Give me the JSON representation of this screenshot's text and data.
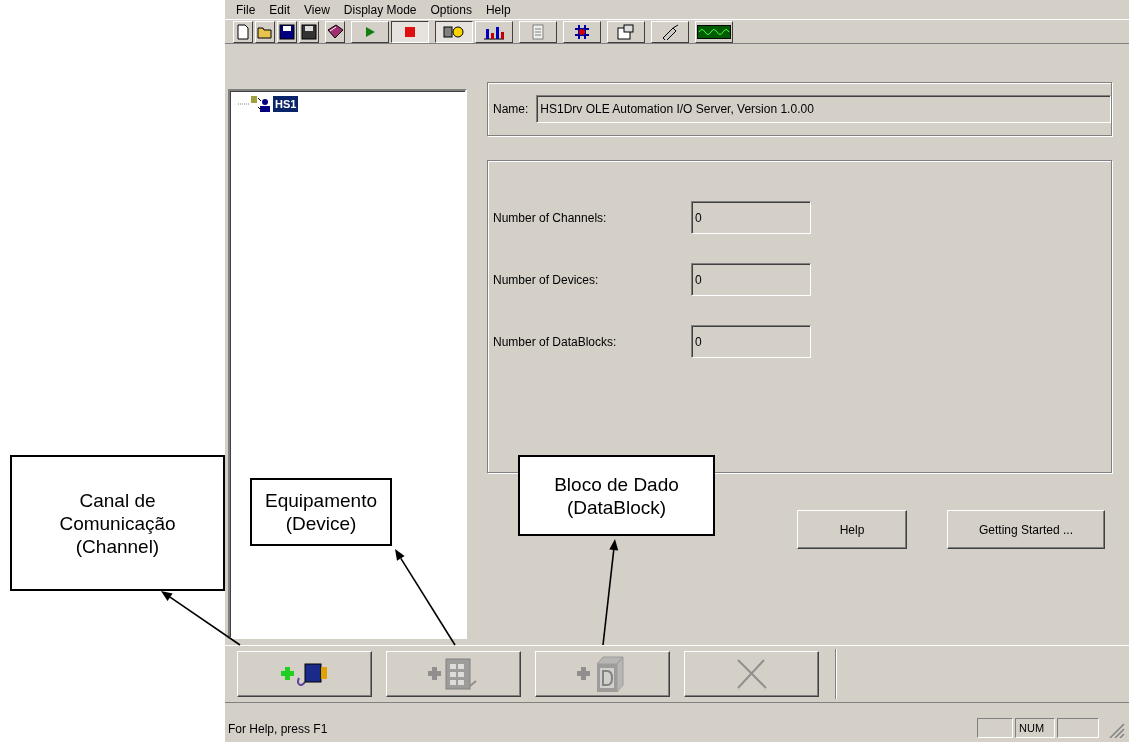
{
  "menu": [
    "File",
    "Edit",
    "View",
    "Display Mode",
    "Options",
    "Help"
  ],
  "toolbar": [
    [
      {
        "kind": "new",
        "pressed": false
      },
      {
        "kind": "open",
        "pressed": false
      },
      {
        "kind": "save",
        "pressed": false
      },
      {
        "kind": "saveall",
        "pressed": false
      }
    ],
    [
      {
        "kind": "book",
        "pressed": false
      }
    ],
    [
      {
        "kind": "play",
        "pressed": false
      },
      {
        "kind": "stop",
        "pressed": true
      }
    ],
    [
      {
        "kind": "config",
        "pressed": true
      },
      {
        "kind": "chart",
        "pressed": false
      }
    ],
    [
      {
        "kind": "doc",
        "pressed": false
      }
    ],
    [
      {
        "kind": "network",
        "pressed": false
      }
    ],
    [
      {
        "kind": "props",
        "pressed": false
      }
    ],
    [
      {
        "kind": "probe",
        "pressed": false
      }
    ],
    [
      {
        "kind": "monitor",
        "pressed": false
      }
    ]
  ],
  "tree": [
    {
      "label": "HS1",
      "selected": true
    }
  ],
  "name_field": {
    "label": "Name:",
    "value": "HS1Drv OLE Automation I/O Server, Version 1.0.00"
  },
  "stats": [
    {
      "label": "Number of Channels:",
      "value": "0"
    },
    {
      "label": "Number of Devices:",
      "value": "0"
    },
    {
      "label": "Number of DataBlocks:",
      "value": "0"
    }
  ],
  "buttons": [
    "Help",
    "Getting Started ..."
  ],
  "bottom_buttons": [
    {
      "kind": "channel",
      "disabled": false
    },
    {
      "kind": "device",
      "disabled": true
    },
    {
      "kind": "datablock",
      "disabled": true
    },
    {
      "kind": "delete",
      "disabled": true
    }
  ],
  "status_bar": {
    "text": "For Help, press F1",
    "indicators": [
      "NUM"
    ]
  },
  "callouts": [
    {
      "text": "Canal de\nComunicação\n(Channel)"
    },
    {
      "text": "Equipamento\n(Device)"
    },
    {
      "text": "Bloco de Dado\n(DataBlock)"
    }
  ]
}
